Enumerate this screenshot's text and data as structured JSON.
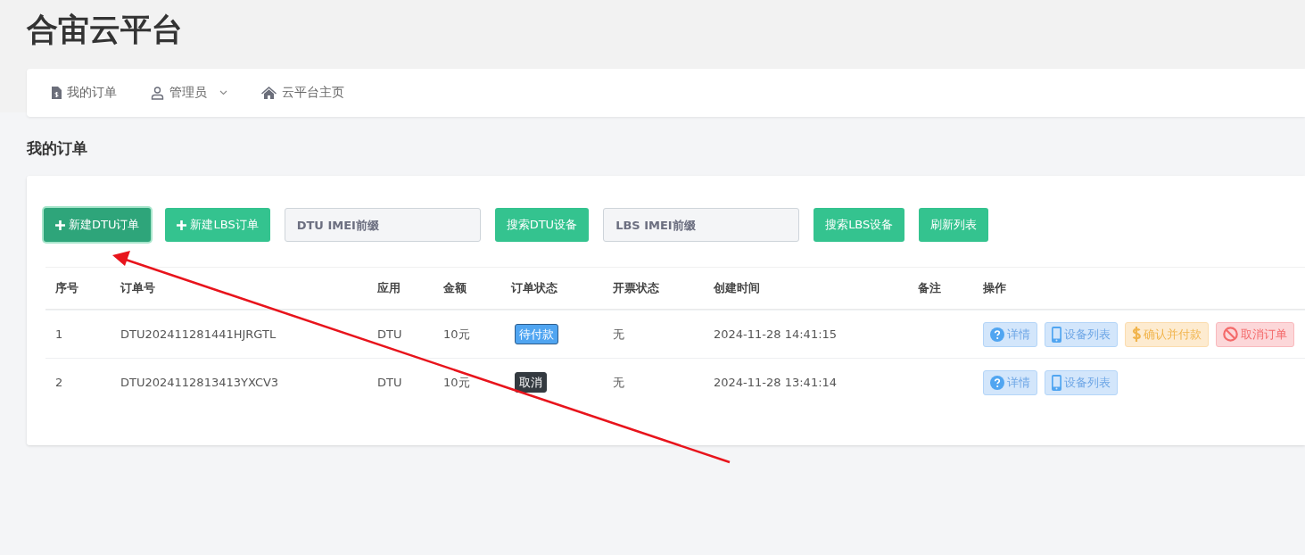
{
  "app_title": "合宙云平台",
  "nav": [
    {
      "label": "我的订单",
      "dropdown": false
    },
    {
      "label": "管理员",
      "dropdown": true
    },
    {
      "label": "云平台主页",
      "dropdown": false
    }
  ],
  "page_heading": "我的订单",
  "toolbar": [
    {
      "kind": "create",
      "label": "新建DTU订单",
      "focused": true
    },
    {
      "kind": "create",
      "label": "新建LBS订单",
      "focused": false
    },
    {
      "kind": "field",
      "placeholder": "DTU IMEI前缀"
    },
    {
      "kind": "button",
      "label": "搜索DTU设备",
      "focused": false
    },
    {
      "kind": "field",
      "placeholder": "LBS IMEI前缀"
    },
    {
      "kind": "button",
      "label": "搜索LBS设备",
      "focused": false
    },
    {
      "kind": "button",
      "label": "刷新列表",
      "focused": false
    }
  ],
  "table": {
    "columns": [
      "序号",
      "订单号",
      "应用",
      "金额",
      "订单状态",
      "开票状态",
      "创建时间",
      "备注",
      "操作"
    ],
    "rows": [
      {
        "index": "1",
        "order_no": "DTU202411281441HJRGTL",
        "app": "DTU",
        "amount": "10元",
        "status": {
          "label": "待付款",
          "kind": "pending"
        },
        "invoice": "无",
        "created": "2024-11-28 14:41:15",
        "actions": [
          {
            "kind": "info",
            "label": "详情"
          },
          {
            "kind": "devices",
            "label": "设备列表"
          },
          {
            "kind": "pay",
            "label": "确认并付款"
          },
          {
            "kind": "cancel",
            "label": "取消订单"
          }
        ]
      },
      {
        "index": "2",
        "order_no": "DTU2024112813413YXCV3",
        "app": "DTU",
        "amount": "10元",
        "status": {
          "label": "取消",
          "kind": "cancelled"
        },
        "invoice": "无",
        "created": "2024-11-28 13:41:14",
        "actions": [
          {
            "kind": "info",
            "label": "详情"
          },
          {
            "kind": "devices",
            "label": "设备列表"
          }
        ]
      }
    ]
  },
  "annotation": {
    "kind": "arrow"
  }
}
